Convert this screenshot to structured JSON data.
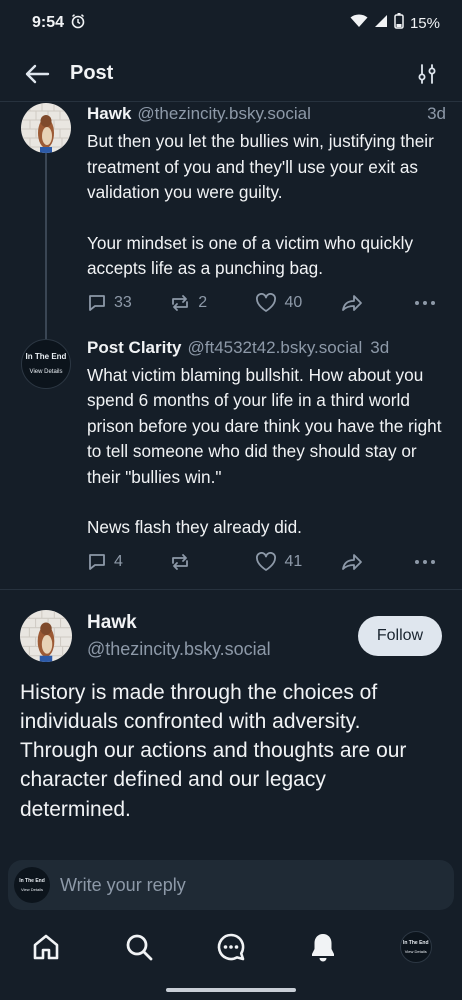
{
  "status_bar": {
    "time": "9:54",
    "battery": "15%"
  },
  "header": {
    "title": "Post"
  },
  "replies": [
    {
      "name": "Hawk",
      "handle": "@thezincity.bsky.social",
      "ago": "3d",
      "paragraphs": [
        "But then you let the bullies win, justifying their treatment of you and they'll use your exit as validation you were guilty.",
        "Your mindset is one of a victim who quickly accepts life as a punching bag."
      ],
      "replies_count": "33",
      "reposts_count": "2",
      "likes_count": "40"
    },
    {
      "name": "Post Clarity",
      "handle": "@ft4532t42.bsky.social",
      "ago": "3d",
      "avatar_line1": "In The End",
      "avatar_line2": "View Details",
      "paragraphs": [
        "What victim blaming bullshit. How about you spend 6 months of your life in a third world prison before you dare think you have the right to tell someone who did they should stay or their \"bullies win.\"",
        "News flash they already did."
      ],
      "replies_count": "4",
      "reposts_count": "",
      "likes_count": "41"
    }
  ],
  "main_post": {
    "name": "Hawk",
    "handle": "@thezincity.bsky.social",
    "follow_label": "Follow",
    "text": "History is made through the choices of individuals confronted with adversity. Through our actions and thoughts are our character defined and our legacy determined."
  },
  "reply_bar": {
    "placeholder": "Write your reply",
    "avatar_line1": "In The End",
    "avatar_line2": "View Details"
  },
  "nav": {
    "items": [
      "home-icon",
      "search-icon",
      "chat-icon",
      "notifications-icon",
      "profile-avatar"
    ],
    "avatar_line1": "In The End",
    "avatar_line2": "View Details"
  },
  "colors": {
    "background": "#151e28",
    "muted_text": "#8d99a8",
    "follow_button": "#dfe6ee"
  }
}
